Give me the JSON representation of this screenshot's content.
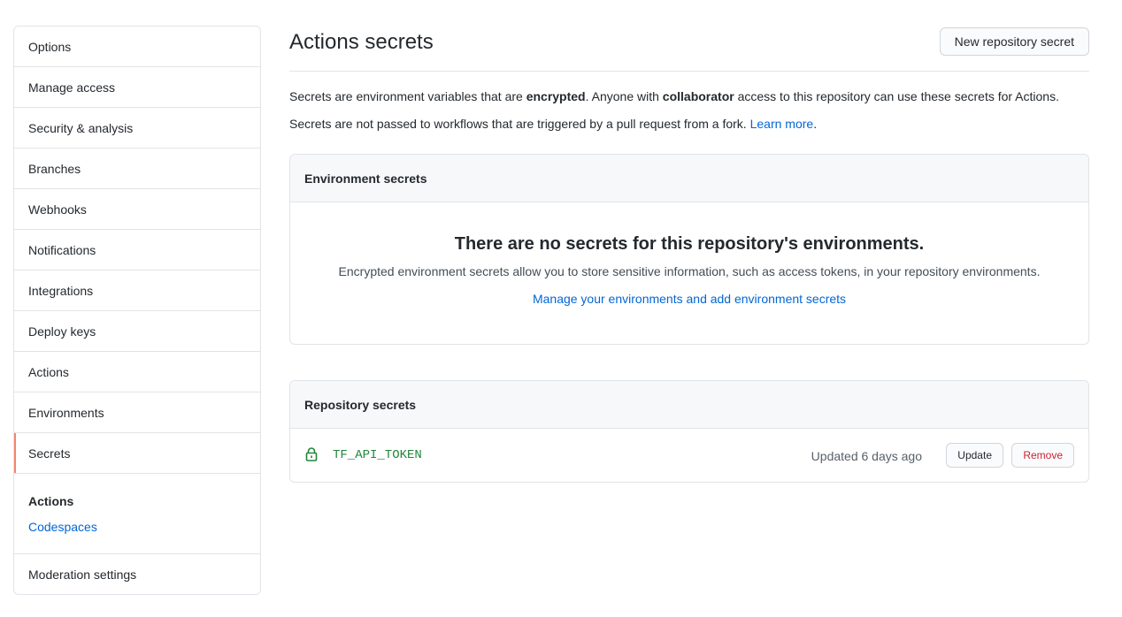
{
  "sidebar": {
    "items": [
      {
        "label": "Options"
      },
      {
        "label": "Manage access"
      },
      {
        "label": "Security & analysis"
      },
      {
        "label": "Branches"
      },
      {
        "label": "Webhooks"
      },
      {
        "label": "Notifications"
      },
      {
        "label": "Integrations"
      },
      {
        "label": "Deploy keys"
      },
      {
        "label": "Actions"
      },
      {
        "label": "Environments"
      },
      {
        "label": "Secrets",
        "selected": true
      }
    ],
    "group": {
      "heading": "Actions",
      "link": "Codespaces"
    },
    "last_item": "Moderation settings"
  },
  "main": {
    "title": "Actions secrets",
    "new_button": "New repository secret",
    "desc1": {
      "p1": "Secrets are environment variables that are ",
      "b1": "encrypted",
      "p2": ". Anyone with ",
      "b2": "collaborator",
      "p3": " access to this repository can use these secrets for Actions."
    },
    "desc2": {
      "text": "Secrets are not passed to workflows that are triggered by a pull request from a fork. ",
      "link": "Learn more",
      "end": "."
    },
    "env_box": {
      "header": "Environment secrets",
      "blank_title": "There are no secrets for this repository's environments.",
      "blank_desc": "Encrypted environment secrets allow you to store sensitive information, such as access tokens, in your repository environments.",
      "blank_link": "Manage your environments and add environment secrets"
    },
    "repo_box": {
      "header": "Repository secrets",
      "secrets": [
        {
          "name": "TF_API_TOKEN",
          "updated": "Updated 6 days ago",
          "update_label": "Update",
          "remove_label": "Remove"
        }
      ]
    }
  },
  "colors": {
    "accent": "#0366d6",
    "selected_border": "#f9826c",
    "secret_name": "#22863a",
    "danger": "#cb2431"
  },
  "icons": {
    "secret": "lock-icon"
  }
}
